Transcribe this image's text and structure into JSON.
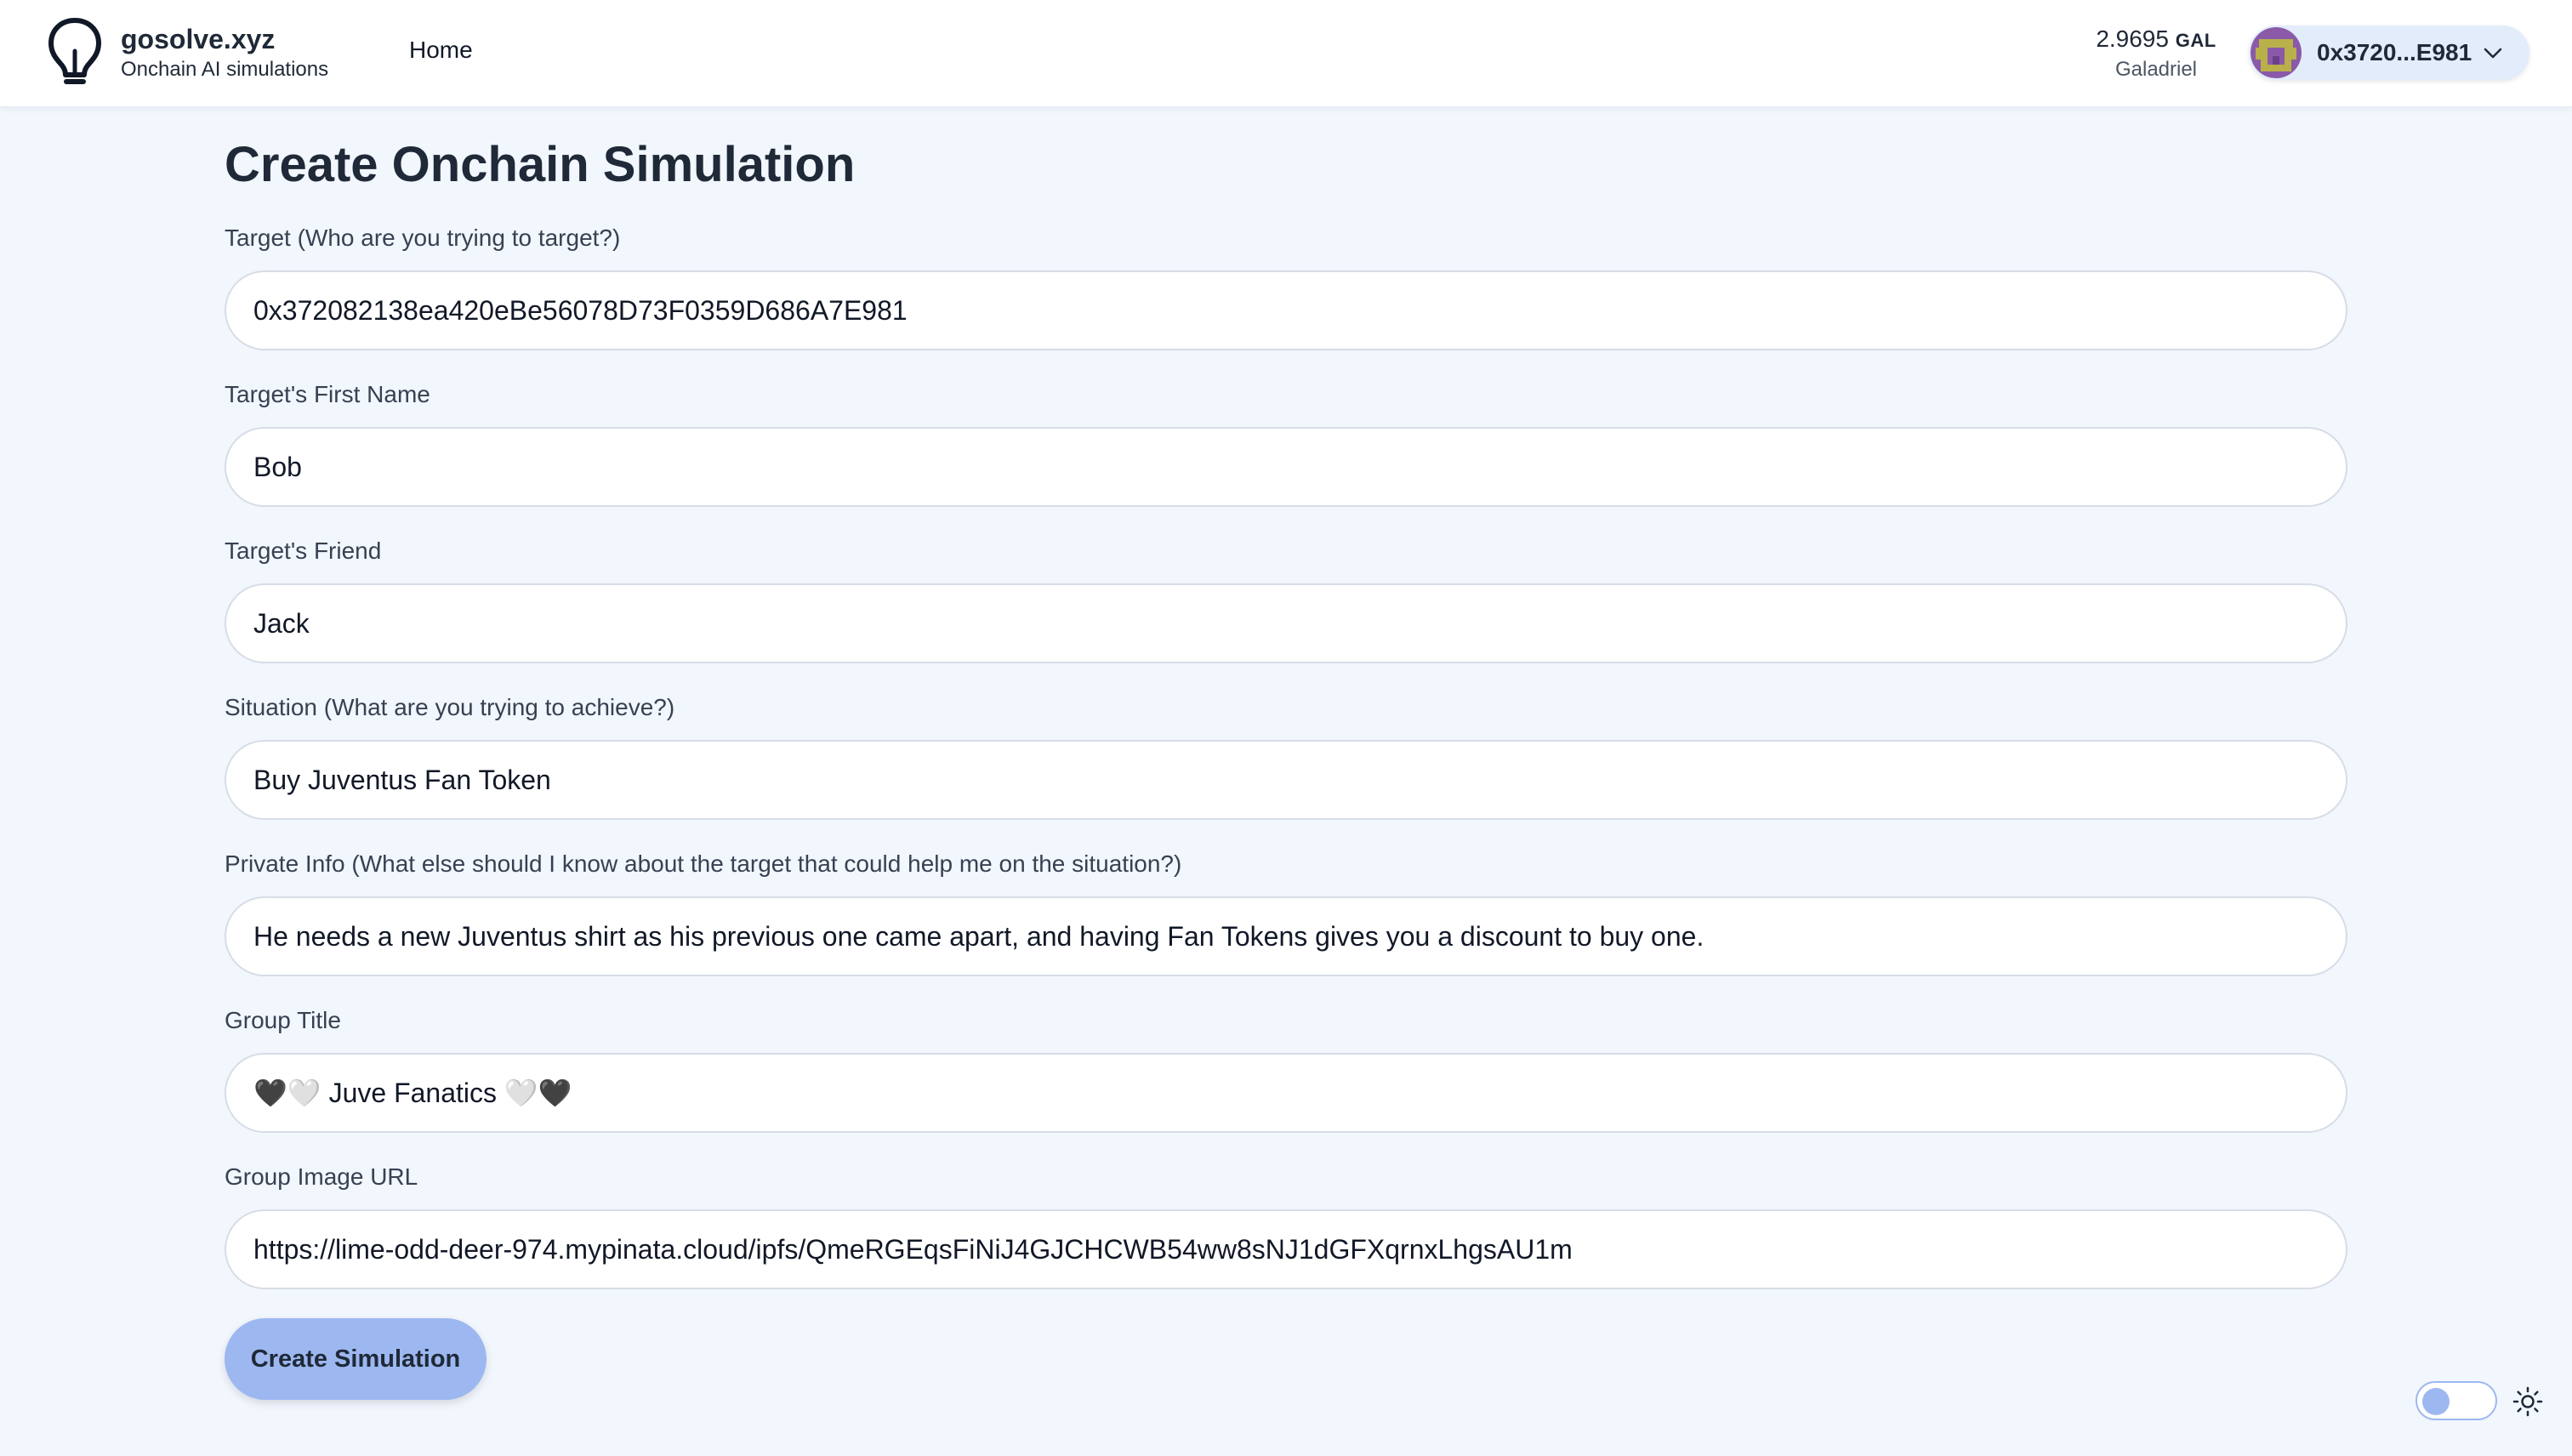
{
  "header": {
    "brand_name": "gosolve.xyz",
    "brand_tagline": "Onchain AI simulations",
    "nav_home": "Home",
    "balance_amount": "2.9695",
    "balance_unit": "GAL",
    "network": "Galadriel",
    "wallet_address": "0x3720...E981"
  },
  "form": {
    "title": "Create Onchain Simulation",
    "fields": [
      {
        "label": "Target (Who are you trying to target?)",
        "value": "0x372082138ea420eBe56078D73F0359D686A7E981"
      },
      {
        "label": "Target's First Name",
        "value": "Bob"
      },
      {
        "label": "Target's Friend",
        "value": "Jack"
      },
      {
        "label": "Situation (What are you trying to achieve?)",
        "value": "Buy Juventus Fan Token"
      },
      {
        "label": "Private Info (What else should I know about the target that could help me on the situation?)",
        "value": "He needs a new Juventus shirt as his previous one came apart, and having Fan Tokens gives you a discount to buy one."
      },
      {
        "label": "Group Title",
        "value": "🖤🤍 Juve Fanatics 🤍🖤"
      },
      {
        "label": "Group Image URL",
        "value": "https://lime-odd-deer-974.mypinata.cloud/ipfs/QmeRGEqsFiNiJ4GJCHCWB54ww8sNJ1dGFXqrnxLhgsAU1m"
      }
    ],
    "submit_label": "Create Simulation"
  },
  "theme": {
    "accent": "#9db8f0",
    "background": "#f2f6fd",
    "icons": [
      "lightbulb-icon",
      "chevron-down-icon",
      "sun-icon"
    ]
  }
}
